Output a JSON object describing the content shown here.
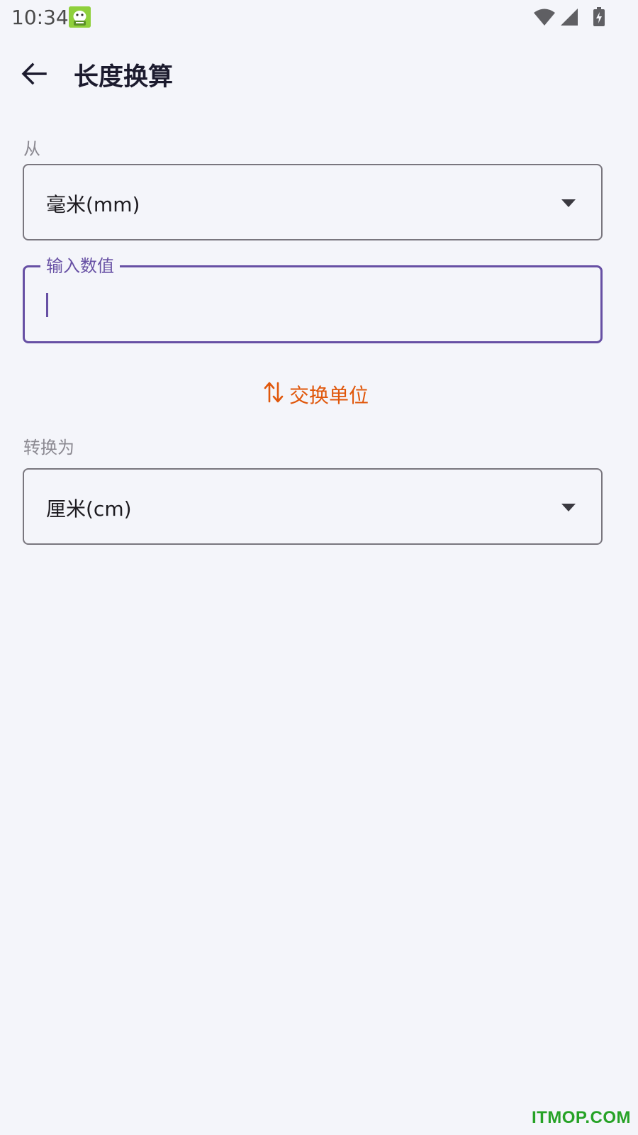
{
  "status_bar": {
    "time": "10:34",
    "icons": [
      "app-notification-icon",
      "wifi-icon",
      "cellular-signal-icon",
      "battery-charging-icon"
    ]
  },
  "app_bar": {
    "back_icon": "arrow-back-icon",
    "title": "长度换算"
  },
  "from": {
    "label": "从",
    "selected": "毫米(mm)"
  },
  "input": {
    "label": "输入数值",
    "value": ""
  },
  "swap": {
    "icon": "swap-vert-icon",
    "label": "交换单位"
  },
  "to": {
    "label": "转换为",
    "selected": "厘米(cm)"
  },
  "colors": {
    "accent": "#6750a4",
    "swap": "#e0570b",
    "watermark": "#26a226"
  },
  "watermark": "ITMOP.COM"
}
